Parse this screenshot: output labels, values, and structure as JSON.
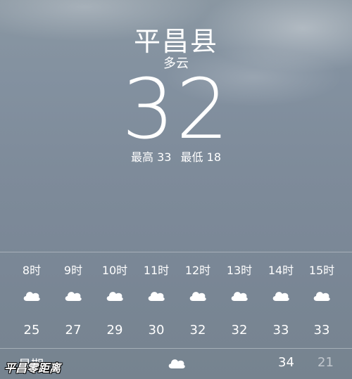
{
  "location": {
    "city": "平昌县",
    "condition": "多云",
    "temperature": "32",
    "high": "最高 33",
    "low": "最低 18"
  },
  "hourly": [
    {
      "time": "8时",
      "icon": "cloud-icon",
      "temp": "25"
    },
    {
      "time": "9时",
      "icon": "cloud-icon",
      "temp": "27"
    },
    {
      "time": "10时",
      "icon": "cloud-icon",
      "temp": "29"
    },
    {
      "time": "11时",
      "icon": "cloud-icon",
      "temp": "30"
    },
    {
      "time": "12时",
      "icon": "cloud-icon",
      "temp": "32"
    },
    {
      "time": "13时",
      "icon": "cloud-icon",
      "temp": "32"
    },
    {
      "time": "14时",
      "icon": "cloud-icon",
      "temp": "33"
    },
    {
      "time": "15时",
      "icon": "cloud-icon",
      "temp": "33"
    }
  ],
  "daily": [
    {
      "day": "星期一",
      "icon": "cloud-icon",
      "high": "34",
      "low": "21"
    }
  ],
  "watermark": "平昌零距离",
  "colors": {
    "text": "#ffffff",
    "sky_top": "#8a97a2",
    "sky_bottom": "#76838f"
  }
}
